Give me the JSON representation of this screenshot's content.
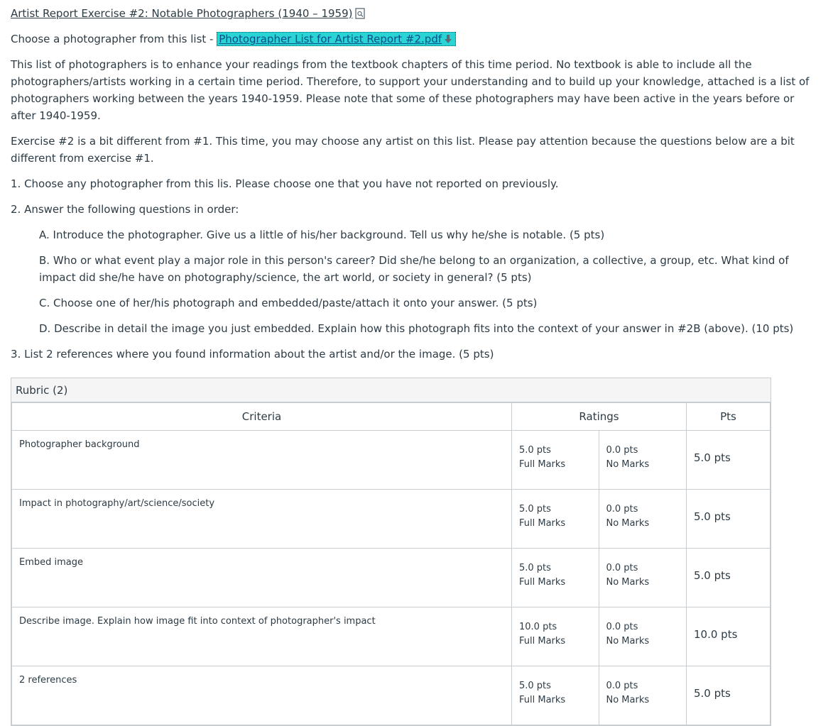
{
  "title": "Artist Report Exercise #2: Notable Photographers (1940 – 1959)",
  "choose_prefix": "Choose a photographer from this list - ",
  "file_link": "Photographer List for Artist Report #2.pdf",
  "intro": "This list of photographers is to enhance your readings from the textbook chapters of this time period. No textbook is able to include all the photographers/artists working in a certain time period. Therefore, to support your understanding and to build up your knowledge, attached is a list of photographers working between the years 1940-1959. Please note that some of these photographers may have been active in the years before or after 1940-1959.",
  "exercise_note": "Exercise #2 is a bit different from #1. This time, you may choose any artist on this list. Please pay attention because the questions below are a bit different from exercise #1.",
  "step1": "1.  Choose any photographer from this lis. Please choose one that you have not reported on previously.",
  "step2": "2. Answer the following questions in order:",
  "qA": "A. Introduce the photographer. Give us a little of his/her background. Tell us why he/she is notable. (5 pts)",
  "qB": "B. Who or what event play a major role in this person's career? Did she/he belong to an organization, a collective, a group, etc. What kind of impact did she/he have on photography/science, the art world, or society in general? (5 pts)",
  "qC": "C. Choose one of her/his photograph and embedded/paste/attach it onto your answer. (5 pts)",
  "qD": "D. Describe in detail the image you just embedded. Explain how this photograph fits into the context of your answer in #2B (above). (10 pts)",
  "step3": "3. List 2 references where you found information about the artist and/or the image. (5 pts)",
  "rubric": {
    "heading": "Rubric (2)",
    "col_criteria": "Criteria",
    "col_ratings": "Ratings",
    "col_pts": "Pts",
    "rows": [
      {
        "criterion": "Photographer background",
        "full_pts": "5.0 pts",
        "full_label": "Full Marks",
        "no_pts": "0.0 pts",
        "no_label": "No Marks",
        "pts": "5.0 pts"
      },
      {
        "criterion": "Impact in photography/art/science/society",
        "full_pts": "5.0 pts",
        "full_label": "Full Marks",
        "no_pts": "0.0 pts",
        "no_label": "No Marks",
        "pts": "5.0 pts"
      },
      {
        "criterion": "Embed image",
        "full_pts": "5.0 pts",
        "full_label": "Full Marks",
        "no_pts": "0.0 pts",
        "no_label": "No Marks",
        "pts": "5.0 pts"
      },
      {
        "criterion": "Describe image. Explain how image fit into context of photographer's impact",
        "full_pts": "10.0 pts",
        "full_label": "Full Marks",
        "no_pts": "0.0 pts",
        "no_label": "No Marks",
        "pts": "10.0 pts"
      },
      {
        "criterion": "2 references",
        "full_pts": "5.0 pts",
        "full_label": "Full Marks",
        "no_pts": "0.0 pts",
        "no_label": "No Marks",
        "pts": "5.0 pts"
      }
    ]
  }
}
